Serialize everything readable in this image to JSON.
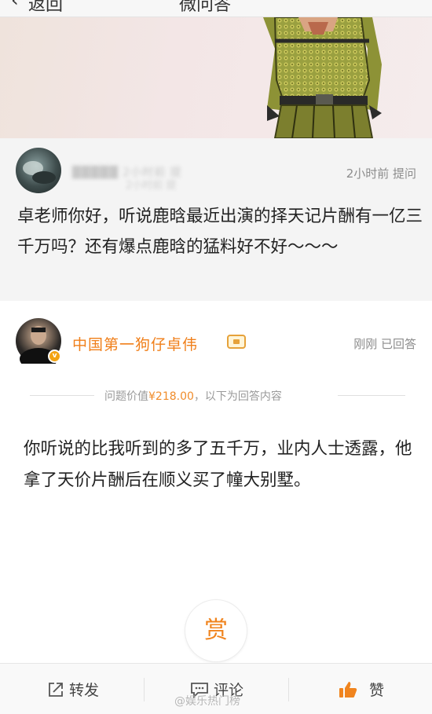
{
  "nav": {
    "back_label": "返回",
    "title": "微问答"
  },
  "question": {
    "asker_name": "█████ 2小时前 提",
    "asker_name_extra": "2小时前 提",
    "meta": "2小时前 提问",
    "text": "卓老师你好，听说鹿晗最近出演的择天记片酬有一亿三千万吗？还有爆点鹿晗的猛料好不好～～～"
  },
  "answerer": {
    "name": "中国第一狗仔卓伟",
    "verified_badge": "v",
    "meta": "刚刚 已回答"
  },
  "price_divider": {
    "prefix": "问题价值",
    "price": "¥218.00",
    "suffix": "，以下为回答内容"
  },
  "answer": {
    "text": "你听说的比我听到的多了五千万，业内人士透露，他拿了天价片酬后在顺义买了幢大别墅。"
  },
  "reward": {
    "label": "赏"
  },
  "toolbar": {
    "repost_label": "转发",
    "comment_label": "评论",
    "like_label": "赞"
  },
  "watermark": "@娱乐热门榜",
  "colors": {
    "accent_orange": "#f07f1a",
    "gold": "#e6a23a",
    "meta_gray": "#8c8c8c"
  },
  "icons": {
    "repost": "share-box-icon",
    "comment": "speech-bubble-icon",
    "like": "thumbs-up-icon"
  }
}
